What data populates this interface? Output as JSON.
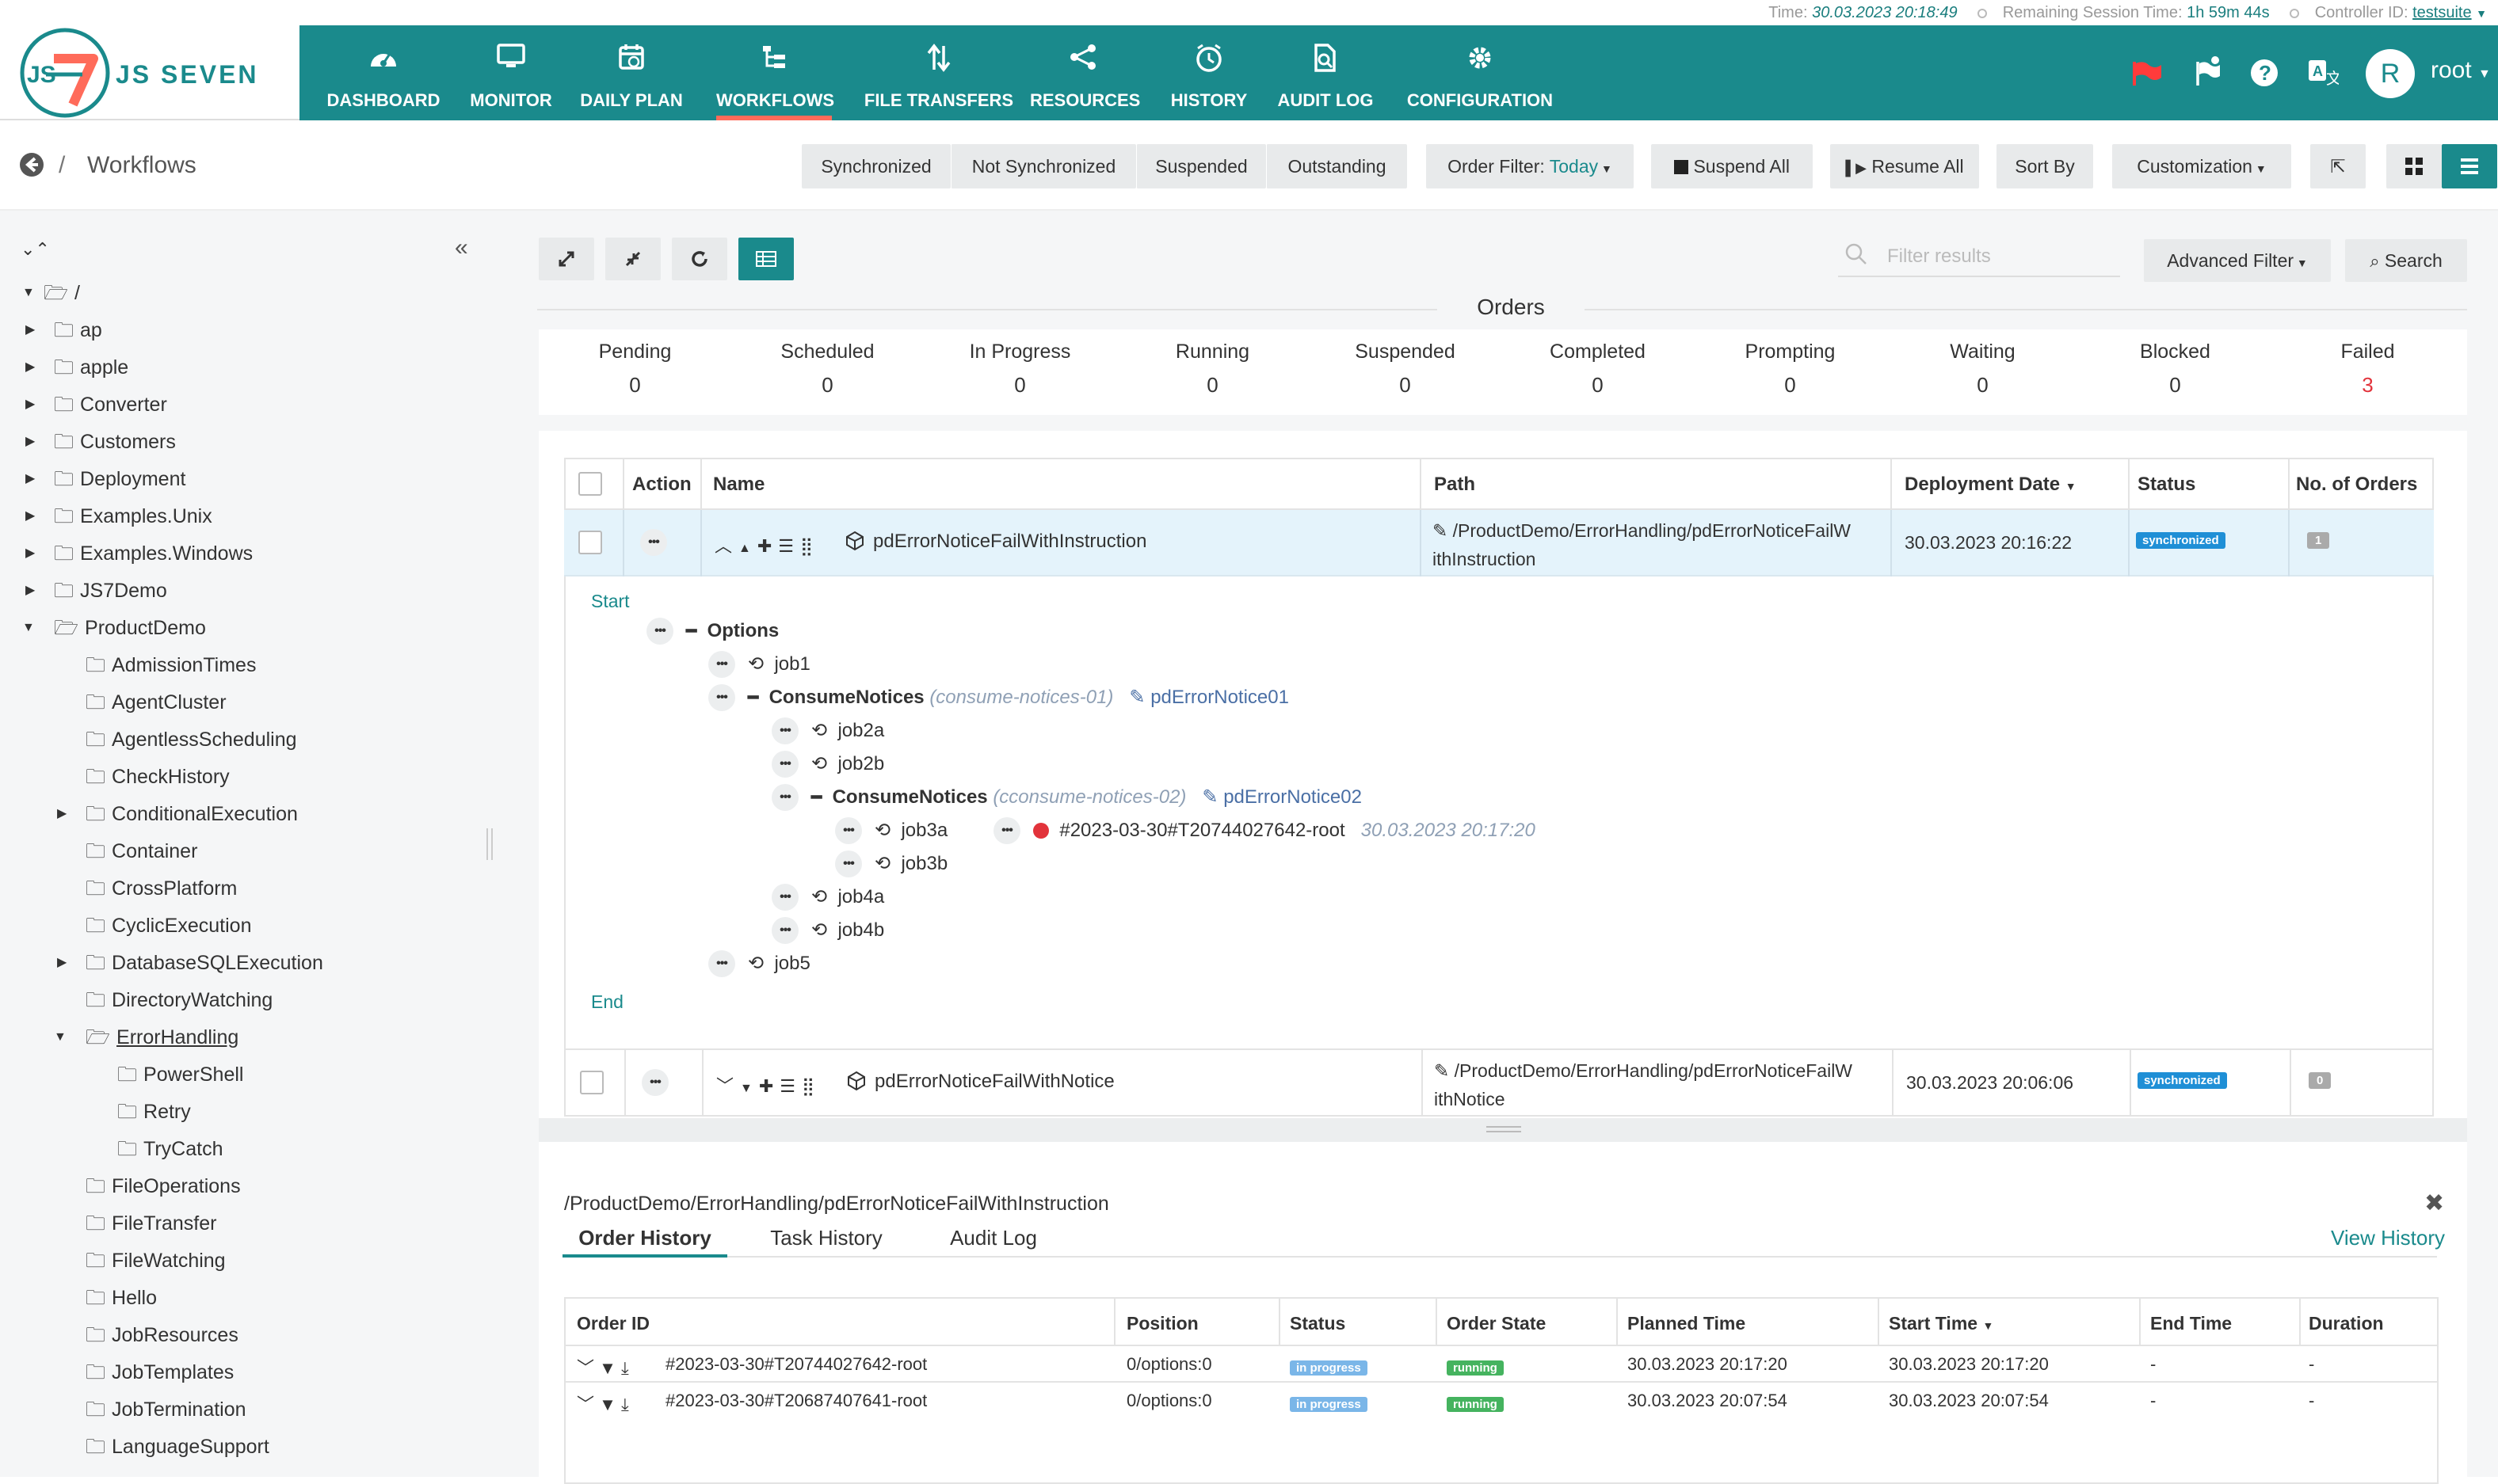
{
  "status_bar": {
    "time_label": "Time:",
    "time_value": "30.03.2023 20:18:49",
    "session_label": "Remaining Session Time:",
    "session_value": "1h 59m 44s",
    "controller_label": "Controller ID:",
    "controller_value": "testsuite"
  },
  "brand": {
    "name": "JS SEVEN",
    "logo_text": "JS7"
  },
  "nav": [
    {
      "label": "DASHBOARD",
      "icon": "dashboard-icon"
    },
    {
      "label": "MONITOR",
      "icon": "monitor-icon"
    },
    {
      "label": "DAILY PLAN",
      "icon": "calendar-icon"
    },
    {
      "label": "WORKFLOWS",
      "icon": "workflow-icon"
    },
    {
      "label": "FILE TRANSFERS",
      "icon": "transfer-icon"
    },
    {
      "label": "RESOURCES",
      "icon": "share-icon"
    },
    {
      "label": "HISTORY",
      "icon": "clock-icon"
    },
    {
      "label": "AUDIT LOG",
      "icon": "audit-icon"
    },
    {
      "label": "CONFIGURATION",
      "icon": "gear-icon"
    }
  ],
  "user": {
    "avatar_letter": "R",
    "name": "root"
  },
  "colors": {
    "primary": "#1a8a8c",
    "accent": "#ff6b5a",
    "failed": "#e2333b",
    "synchronized": "#1f8fd6",
    "in_progress": "#7ab6e8",
    "running": "#45b35f"
  },
  "breadcrumb": {
    "sep": "/",
    "title": "Workflows"
  },
  "toolbar": {
    "filters": [
      "Synchronized",
      "Not Synchronized",
      "Suspended",
      "Outstanding"
    ],
    "order_filter_label": "Order Filter:",
    "order_filter_value": "Today",
    "suspend_all": "Suspend All",
    "resume_all": "Resume All",
    "sort_by": "Sort By",
    "customization": "Customization"
  },
  "tree": {
    "root": "/",
    "items": [
      {
        "label": "ap",
        "level": 1,
        "caret": true
      },
      {
        "label": "apple",
        "level": 1,
        "caret": true
      },
      {
        "label": "Converter",
        "level": 1,
        "caret": true
      },
      {
        "label": "Customers",
        "level": 1,
        "caret": true
      },
      {
        "label": "Deployment",
        "level": 1,
        "caret": true
      },
      {
        "label": "Examples.Unix",
        "level": 1,
        "caret": true
      },
      {
        "label": "Examples.Windows",
        "level": 1,
        "caret": true
      },
      {
        "label": "JS7Demo",
        "level": 1,
        "caret": true
      },
      {
        "label": "ProductDemo",
        "level": 1,
        "caret": "open"
      },
      {
        "label": "AdmissionTimes",
        "level": 2
      },
      {
        "label": "AgentCluster",
        "level": 2
      },
      {
        "label": "AgentlessScheduling",
        "level": 2
      },
      {
        "label": "CheckHistory",
        "level": 2
      },
      {
        "label": "ConditionalExecution",
        "level": 2,
        "caret": true
      },
      {
        "label": "Container",
        "level": 2
      },
      {
        "label": "CrossPlatform",
        "level": 2
      },
      {
        "label": "CyclicExecution",
        "level": 2
      },
      {
        "label": "DatabaseSQLExecution",
        "level": 2,
        "caret": true
      },
      {
        "label": "DirectoryWatching",
        "level": 2
      },
      {
        "label": "ErrorHandling",
        "level": 2,
        "caret": "open"
      },
      {
        "label": "PowerShell",
        "level": 3
      },
      {
        "label": "Retry",
        "level": 3
      },
      {
        "label": "TryCatch",
        "level": 3
      },
      {
        "label": "FileOperations",
        "level": 2
      },
      {
        "label": "FileTransfer",
        "level": 2
      },
      {
        "label": "FileWatching",
        "level": 2
      },
      {
        "label": "Hello",
        "level": 2
      },
      {
        "label": "JobResources",
        "level": 2
      },
      {
        "label": "JobTemplates",
        "level": 2
      },
      {
        "label": "JobTermination",
        "level": 2
      },
      {
        "label": "LanguageSupport",
        "level": 2
      }
    ]
  },
  "search": {
    "placeholder": "Filter results",
    "advanced": "Advanced Filter",
    "button": "Search"
  },
  "orders": {
    "title": "Orders",
    "stats": [
      {
        "label": "Pending",
        "value": "0"
      },
      {
        "label": "Scheduled",
        "value": "0"
      },
      {
        "label": "In Progress",
        "value": "0"
      },
      {
        "label": "Running",
        "value": "0"
      },
      {
        "label": "Suspended",
        "value": "0"
      },
      {
        "label": "Completed",
        "value": "0"
      },
      {
        "label": "Prompting",
        "value": "0"
      },
      {
        "label": "Waiting",
        "value": "0"
      },
      {
        "label": "Blocked",
        "value": "0"
      },
      {
        "label": "Failed",
        "value": "3"
      }
    ]
  },
  "wf_table": {
    "headers": {
      "action": "Action",
      "name": "Name",
      "path": "Path",
      "deployment_date": "Deployment Date",
      "status": "Status",
      "orders": "No. of Orders"
    },
    "rows": [
      {
        "name": "pdErrorNoticeFailWithInstruction",
        "path_line1": "/ProductDemo/ErrorHandling/pdErrorNoticeFailW",
        "path_line2": "ithInstruction",
        "date": "30.03.2023 20:16:22",
        "status": "synchronized",
        "orders": "1"
      },
      {
        "name": "pdErrorNoticeFailWithNotice",
        "path_line1": "/ProductDemo/ErrorHandling/pdErrorNoticeFailW",
        "path_line2": "ithNotice",
        "date": "30.03.2023 20:06:06",
        "status": "synchronized",
        "orders": "0"
      }
    ]
  },
  "workflow": {
    "start": "Start",
    "end": "End",
    "options": "Options",
    "job1": "job1",
    "consume1": "ConsumeNotices",
    "consume1_id": "(consume-notices-01)",
    "notice1": "pdErrorNotice01",
    "job2a": "job2a",
    "job2b": "job2b",
    "consume2": "ConsumeNotices",
    "consume2_id": "(cconsume-notices-02)",
    "notice2": "pdErrorNotice02",
    "job3a": "job3a",
    "order_id": "#2023-03-30#T20744027642-root",
    "order_time": "30.03.2023 20:17:20",
    "job3b": "job3b",
    "job4a": "job4a",
    "job4b": "job4b",
    "job5": "job5"
  },
  "detail": {
    "path": "/ProductDemo/ErrorHandling/pdErrorNoticeFailWithInstruction",
    "tabs": [
      "Order History",
      "Task History",
      "Audit Log"
    ],
    "view_history": "View History",
    "headers": [
      "Order ID",
      "Position",
      "Status",
      "Order State",
      "Planned Time",
      "Start Time",
      "End Time",
      "Duration"
    ],
    "rows": [
      {
        "id": "#2023-03-30#T20744027642-root",
        "position": "0/options:0",
        "status": "in progress",
        "state": "running",
        "planned": "30.03.2023 20:17:20",
        "start": "30.03.2023 20:17:20",
        "end": "-",
        "duration": "-"
      },
      {
        "id": "#2023-03-30#T20687407641-root",
        "position": "0/options:0",
        "status": "in progress",
        "state": "running",
        "planned": "30.03.2023 20:07:54",
        "start": "30.03.2023 20:07:54",
        "end": "-",
        "duration": "-"
      }
    ]
  }
}
